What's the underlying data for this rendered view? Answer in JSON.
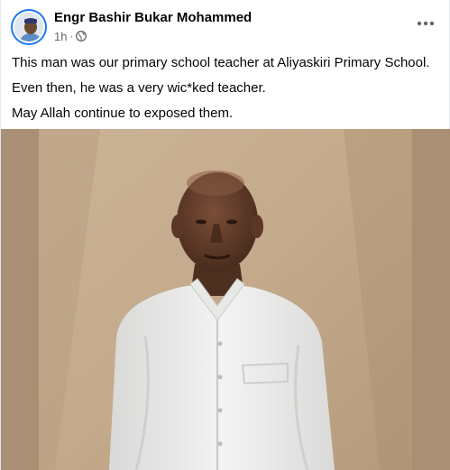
{
  "post": {
    "author_name": "Engr Bashir Bukar Mohammed",
    "timestamp": "1h",
    "separator": "·",
    "privacy_icon": "globe-icon",
    "more_icon": "more-options-icon",
    "paragraphs": [
      "This man was our primary school teacher at Aliyaskiri Primary School.",
      "Even then, he was a very wic*ked teacher.",
      "May Allah continue to exposed them."
    ]
  },
  "colors": {
    "text_primary": "#050505",
    "text_secondary": "#65676b",
    "avatar_ring": "#1877f2",
    "photo_wall": "#c2a88a",
    "photo_side_bars": "#a98f73",
    "shirt": "#efefee"
  }
}
